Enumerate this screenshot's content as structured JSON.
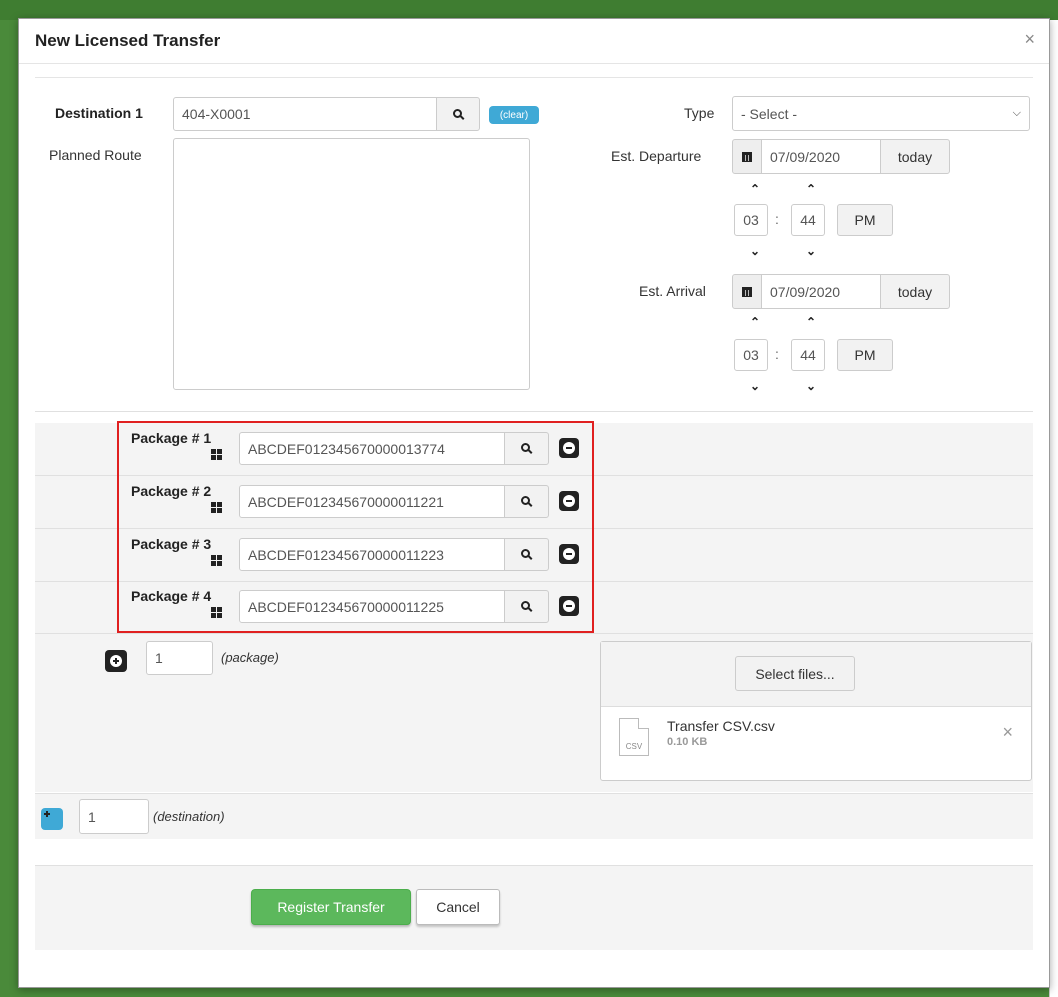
{
  "modal": {
    "title": "New Licensed Transfer",
    "close_glyph": "×"
  },
  "destination": {
    "label": "Destination 1",
    "value": "404-X0001",
    "clear_label": "(clear)",
    "route_label": "Planned Route",
    "route_value": ""
  },
  "transfer_type": {
    "label": "Type",
    "selected": "- Select -"
  },
  "departure": {
    "label": "Est. Departure",
    "date": "07/09/2020",
    "today_label": "today",
    "hour": "03",
    "minute": "44",
    "ampm": "PM"
  },
  "arrival": {
    "label": "Est. Arrival",
    "date": "07/09/2020",
    "today_label": "today",
    "hour": "03",
    "minute": "44",
    "ampm": "PM"
  },
  "packages": [
    {
      "label": "Package # 1",
      "value": "ABCDEF012345670000013774"
    },
    {
      "label": "Package # 2",
      "value": "ABCDEF012345670000011221"
    },
    {
      "label": "Package # 3",
      "value": "ABCDEF012345670000011223"
    },
    {
      "label": "Package # 4",
      "value": "ABCDEF012345670000011225"
    }
  ],
  "add_package": {
    "count": "1",
    "label": "(package)"
  },
  "upload": {
    "select_label": "Select files...",
    "file_name": "Transfer CSV.csv",
    "file_size": "0.10 KB",
    "file_ext": "CSV",
    "remove_glyph": "×"
  },
  "add_destination": {
    "count": "1",
    "label": "(destination)"
  },
  "actions": {
    "register_label": "Register Transfer",
    "cancel_label": "Cancel"
  },
  "colors": {
    "accent_green": "#5cb85c",
    "accent_blue": "#3fa9d6",
    "highlight_red": "#e02020",
    "backdrop_green": "#4a8a3a"
  },
  "icons": {
    "search": "search-icon",
    "remove": "minus-circle-icon",
    "add": "plus-circle-icon",
    "calendar": "calendar-icon",
    "barcode": "grid-icon",
    "file": "file-icon",
    "chevron_up": "chevron-up-icon",
    "chevron_down": "chevron-down-icon"
  }
}
